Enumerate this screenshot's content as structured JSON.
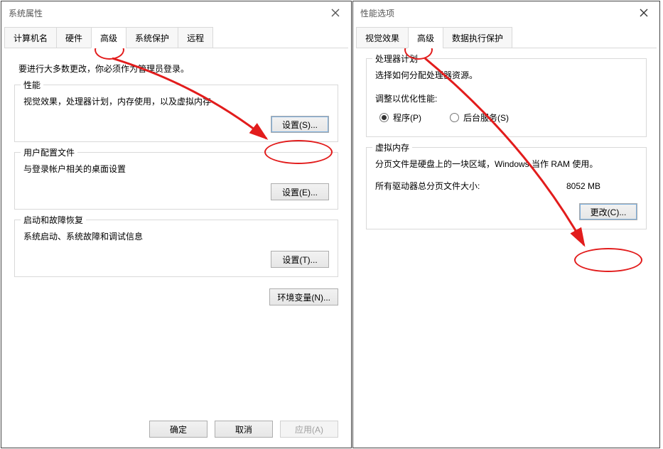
{
  "left": {
    "title": "系统属性",
    "tabs": [
      "计算机名",
      "硬件",
      "高级",
      "系统保护",
      "远程"
    ],
    "active_tab_index": 2,
    "admin_note": "要进行大多数更改，你必须作为管理员登录。",
    "groups": {
      "performance": {
        "legend": "性能",
        "text": "视觉效果，处理器计划，内存使用，以及虚拟内存",
        "button": "设置(S)..."
      },
      "user_profiles": {
        "legend": "用户配置文件",
        "text": "与登录帐户相关的桌面设置",
        "button": "设置(E)..."
      },
      "startup": {
        "legend": "启动和故障恢复",
        "text": "系统启动、系统故障和调试信息",
        "button": "设置(T)..."
      }
    },
    "env_button": "环境变量(N)...",
    "bottom_buttons": {
      "ok": "确定",
      "cancel": "取消",
      "apply": "应用(A)"
    }
  },
  "right": {
    "title": "性能选项",
    "tabs": [
      "视觉效果",
      "高级",
      "数据执行保护"
    ],
    "active_tab_index": 1,
    "processor": {
      "legend": "处理器计划",
      "text": "选择如何分配处理器资源。",
      "optimize_label": "调整以优化性能:",
      "radio_programs": "程序(P)",
      "radio_background": "后台服务(S)",
      "selected": "programs"
    },
    "vmem": {
      "legend": "虚拟内存",
      "text": "分页文件是硬盘上的一块区域，Windows 当作 RAM 使用。",
      "total_label": "所有驱动器总分页文件大小:",
      "total_value": "8052 MB",
      "button": "更改(C)..."
    }
  }
}
